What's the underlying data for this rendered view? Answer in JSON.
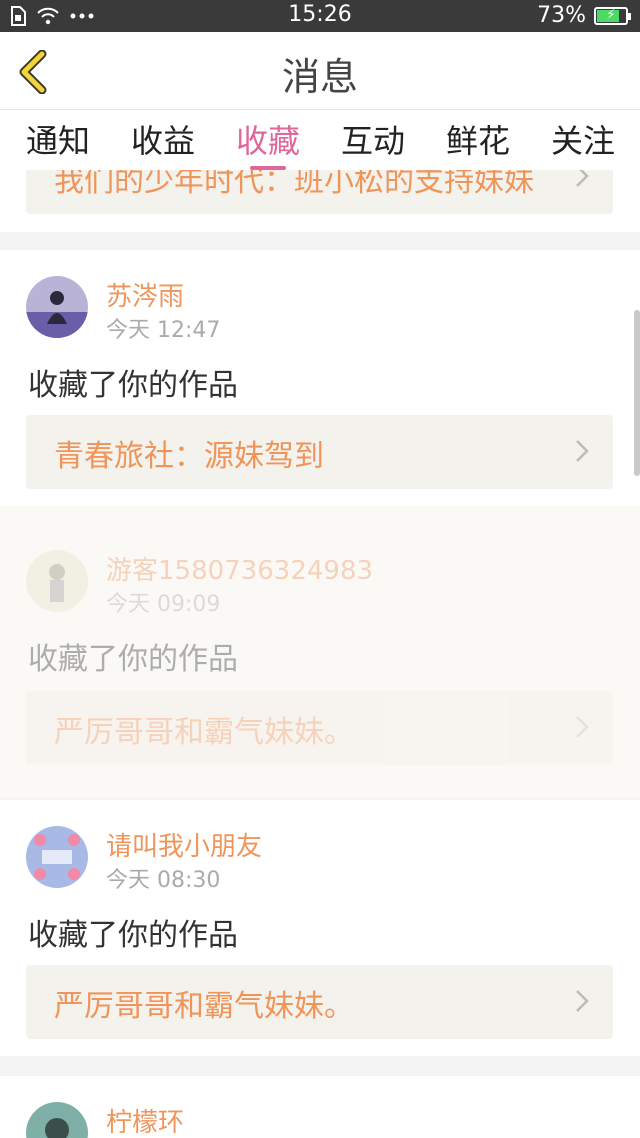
{
  "status_bar": {
    "time": "15:26",
    "battery": "73%",
    "battery_level": 0.73
  },
  "nav": {
    "title": "消息"
  },
  "tabs": [
    {
      "label": "通知"
    },
    {
      "label": "收益"
    },
    {
      "label": "收藏",
      "active": true
    },
    {
      "label": "互动"
    },
    {
      "label": "鲜花"
    },
    {
      "label": "关注"
    }
  ],
  "partial_item": {
    "work_title": "我们的少年时代：班小松的支持妹妹"
  },
  "items": [
    {
      "user": "苏涔雨",
      "time": "今天 12:47",
      "action": "收藏了你的作品",
      "work_title": "青春旅社：源妹驾到"
    },
    {
      "user": "游客1580736324983",
      "time": "今天 09:09",
      "action": "收藏了你的作品",
      "work_title": "严厉哥哥和霸气妹妹。"
    },
    {
      "user": "请叫我小朋友",
      "time": "今天 08:30",
      "action": "收藏了你的作品",
      "work_title": "严厉哥哥和霸气妹妹。"
    },
    {
      "user": "柠檬环"
    }
  ],
  "colors": {
    "accent": "#e0679a",
    "link": "#f0955a",
    "status_bar": "#3a3a3a"
  }
}
